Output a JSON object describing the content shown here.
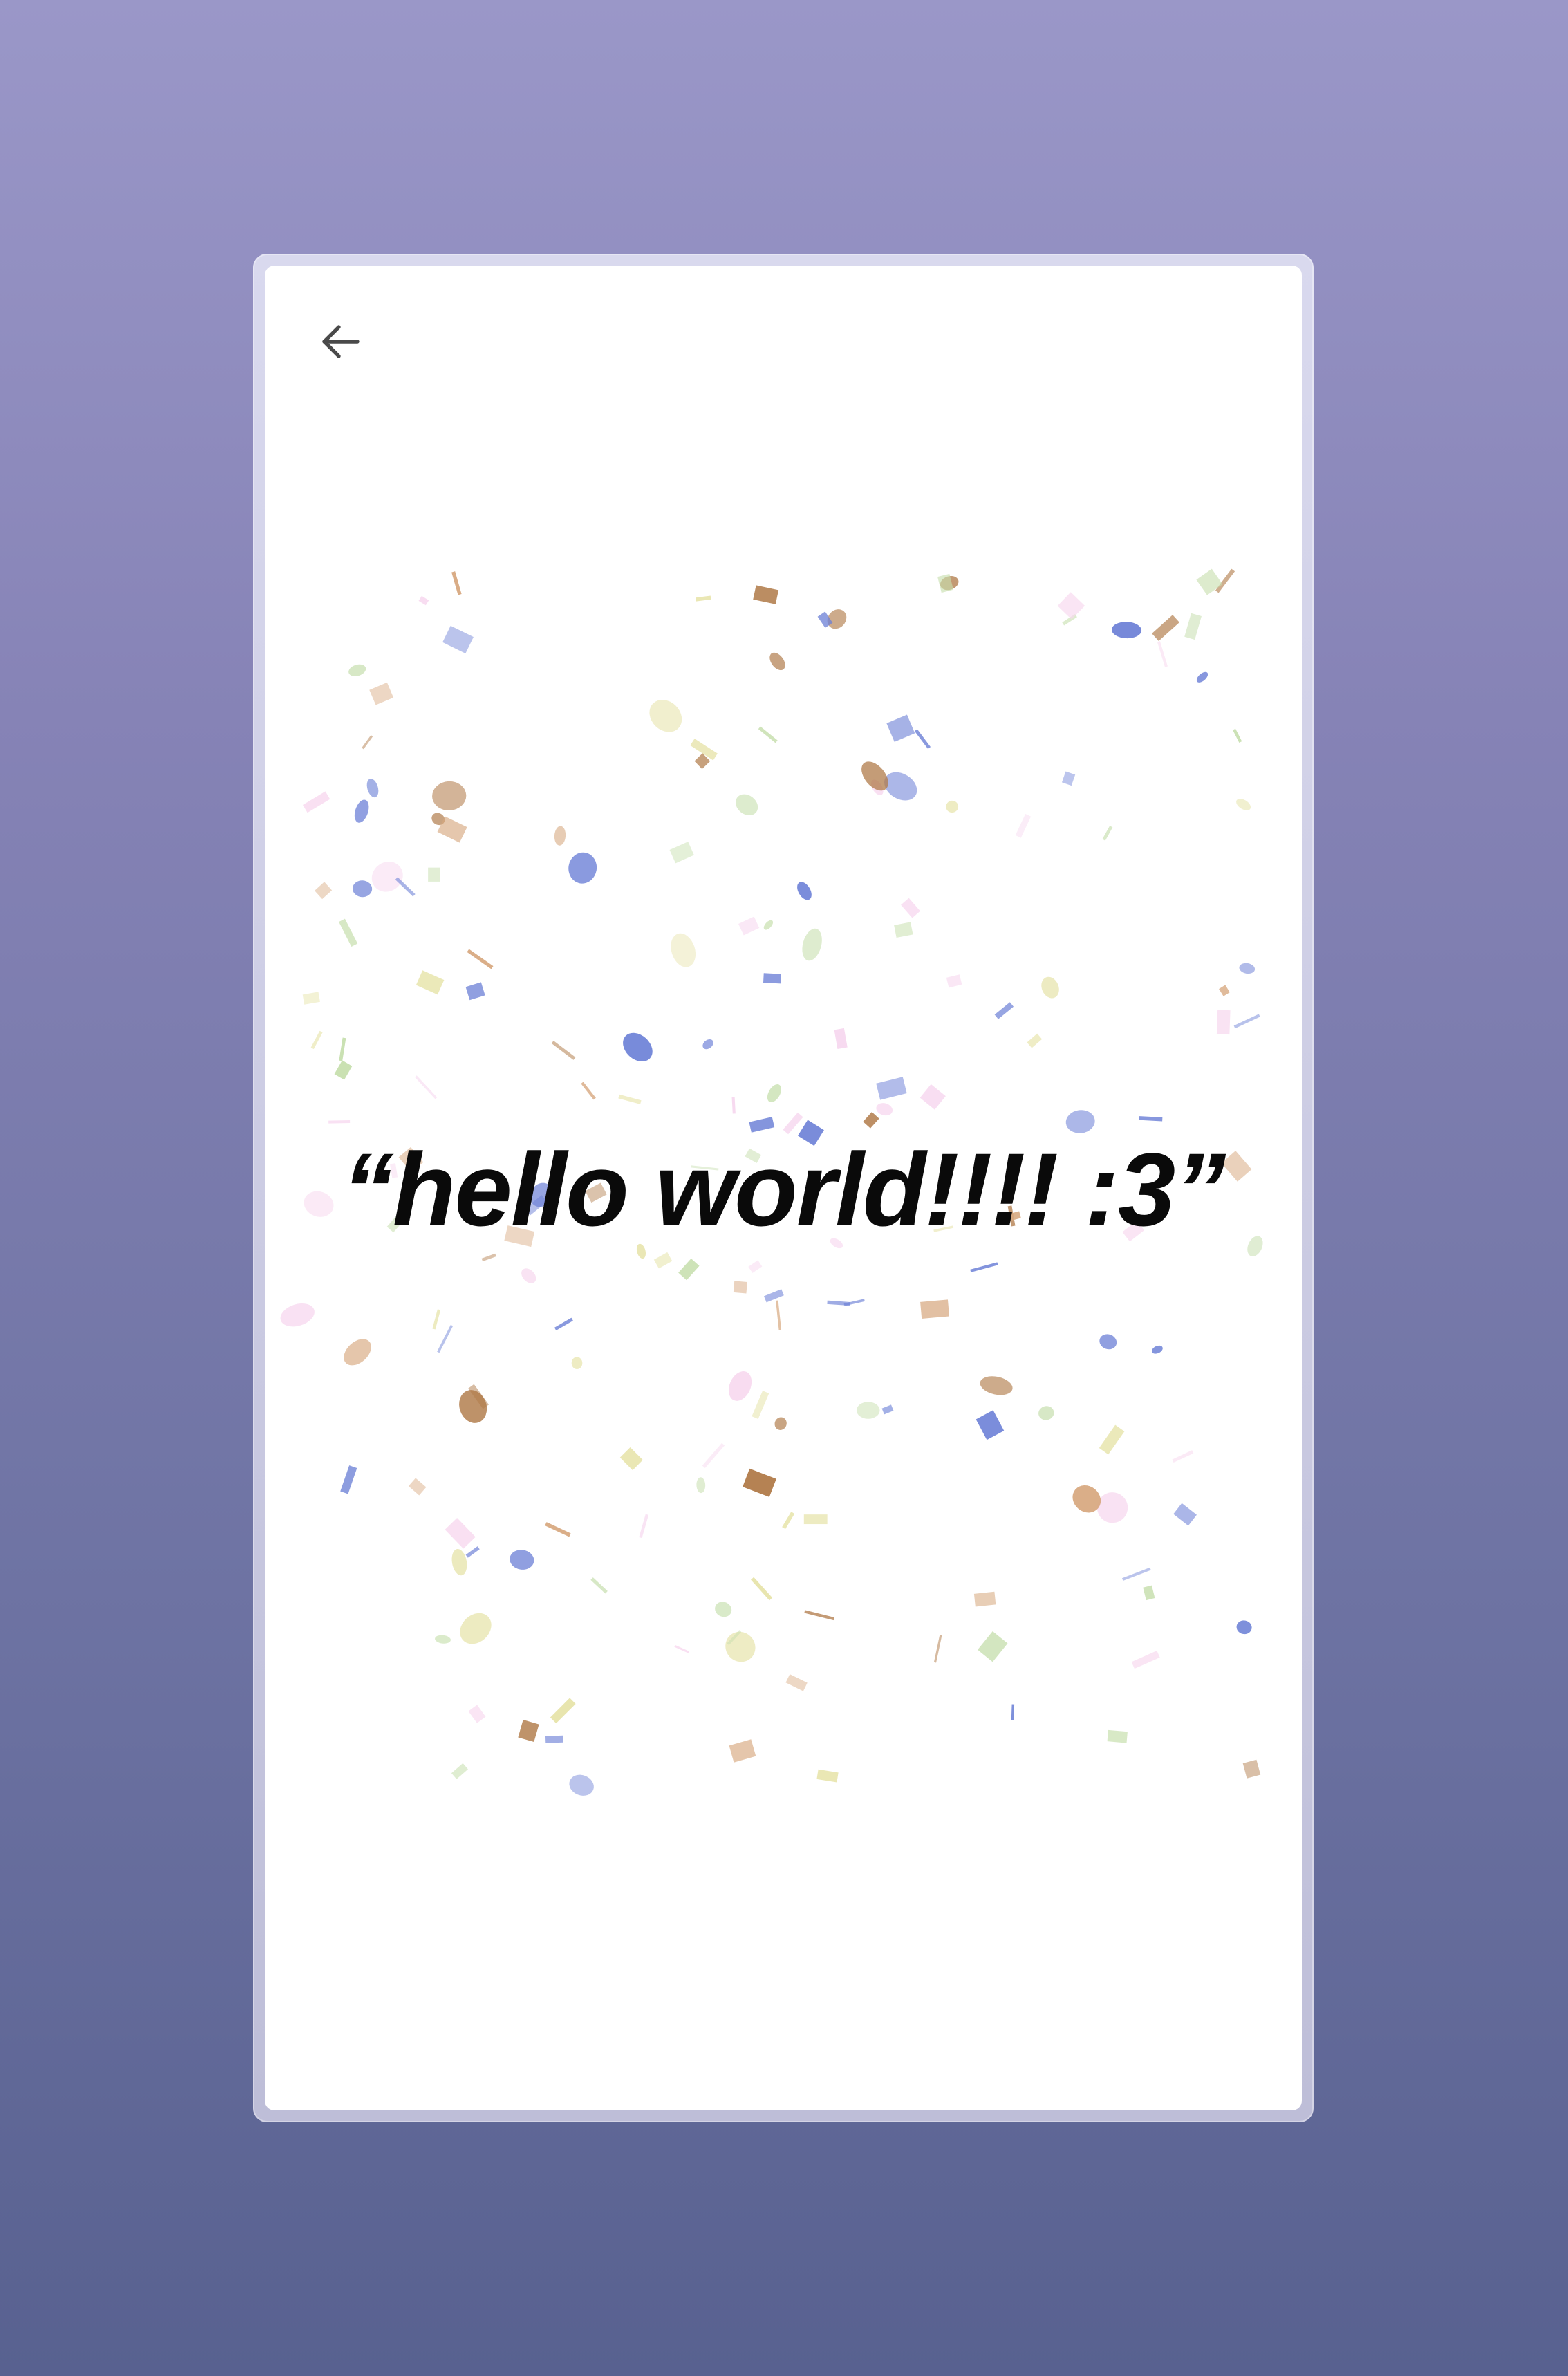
{
  "screen": {
    "message": "“hello world!!!! :3”",
    "back_icon": "arrow-left-icon"
  },
  "colors": {
    "background_top": "#9a97c8",
    "background_bottom": "#586190",
    "card": "#ffffff",
    "text": "#0a0a0a",
    "confetti": [
      "#6b7fd6",
      "#b07a48",
      "#c7dfae",
      "#e6e3a8",
      "#f7d8ef",
      "#d7a87f"
    ]
  }
}
